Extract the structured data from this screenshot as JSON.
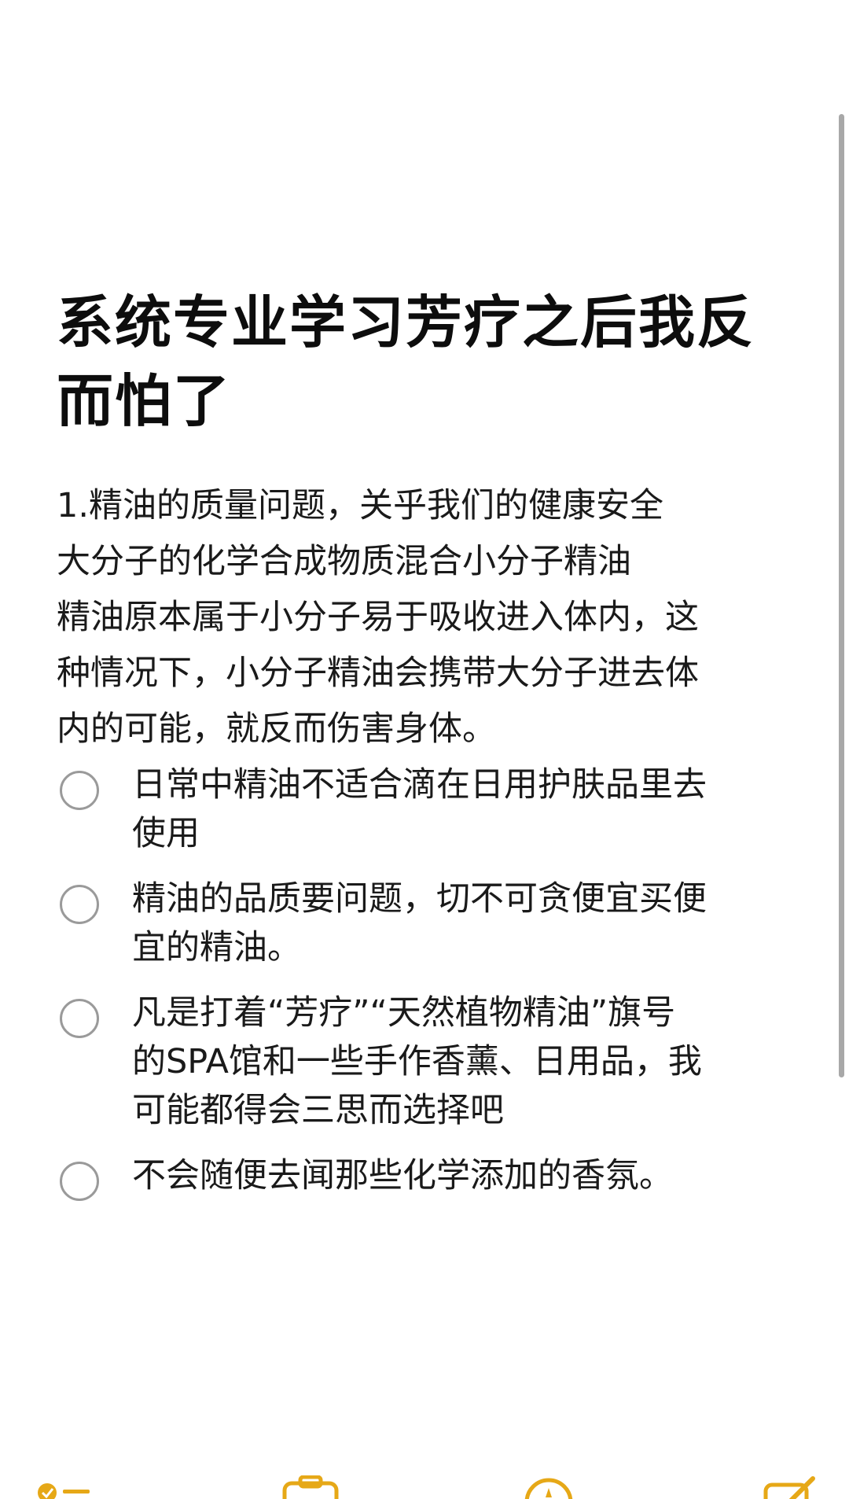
{
  "note": {
    "title_lines": [
      "系统专业学习芳疗之后我反",
      "而怕了"
    ],
    "paragraph_lines": [
      "1.精油的质量问题，关乎我们的健康安全",
      "大分子的化学合成物质混合小分子精油",
      "精油原本属于小分子易于吸收进入体内，这",
      "种情况下，小分子精油会携带大分子进去体",
      "内的可能，就反而伤害身体。"
    ],
    "checklist": [
      {
        "lines": [
          "日常中精油不适合滴在日用护肤品里去",
          "使用"
        ],
        "checked": false
      },
      {
        "lines": [
          "精油的品质要问题，切不可贪便宜买便",
          "宜的精油。"
        ],
        "checked": false
      },
      {
        "lines": [
          "凡是打着“芳疗”“天然植物精油”旗号",
          "的SPA馆和一些手作香薰、日用品，我",
          "可能都得会三思而选择吧"
        ],
        "checked": false
      },
      {
        "lines": [
          "不会随便去闻那些化学添加的香氛。"
        ],
        "checked": false
      }
    ]
  },
  "toolbar": {
    "icons": [
      "checklist-icon",
      "camera-icon",
      "markup-icon",
      "compose-icon"
    ],
    "accent_color": "#e6a817"
  }
}
